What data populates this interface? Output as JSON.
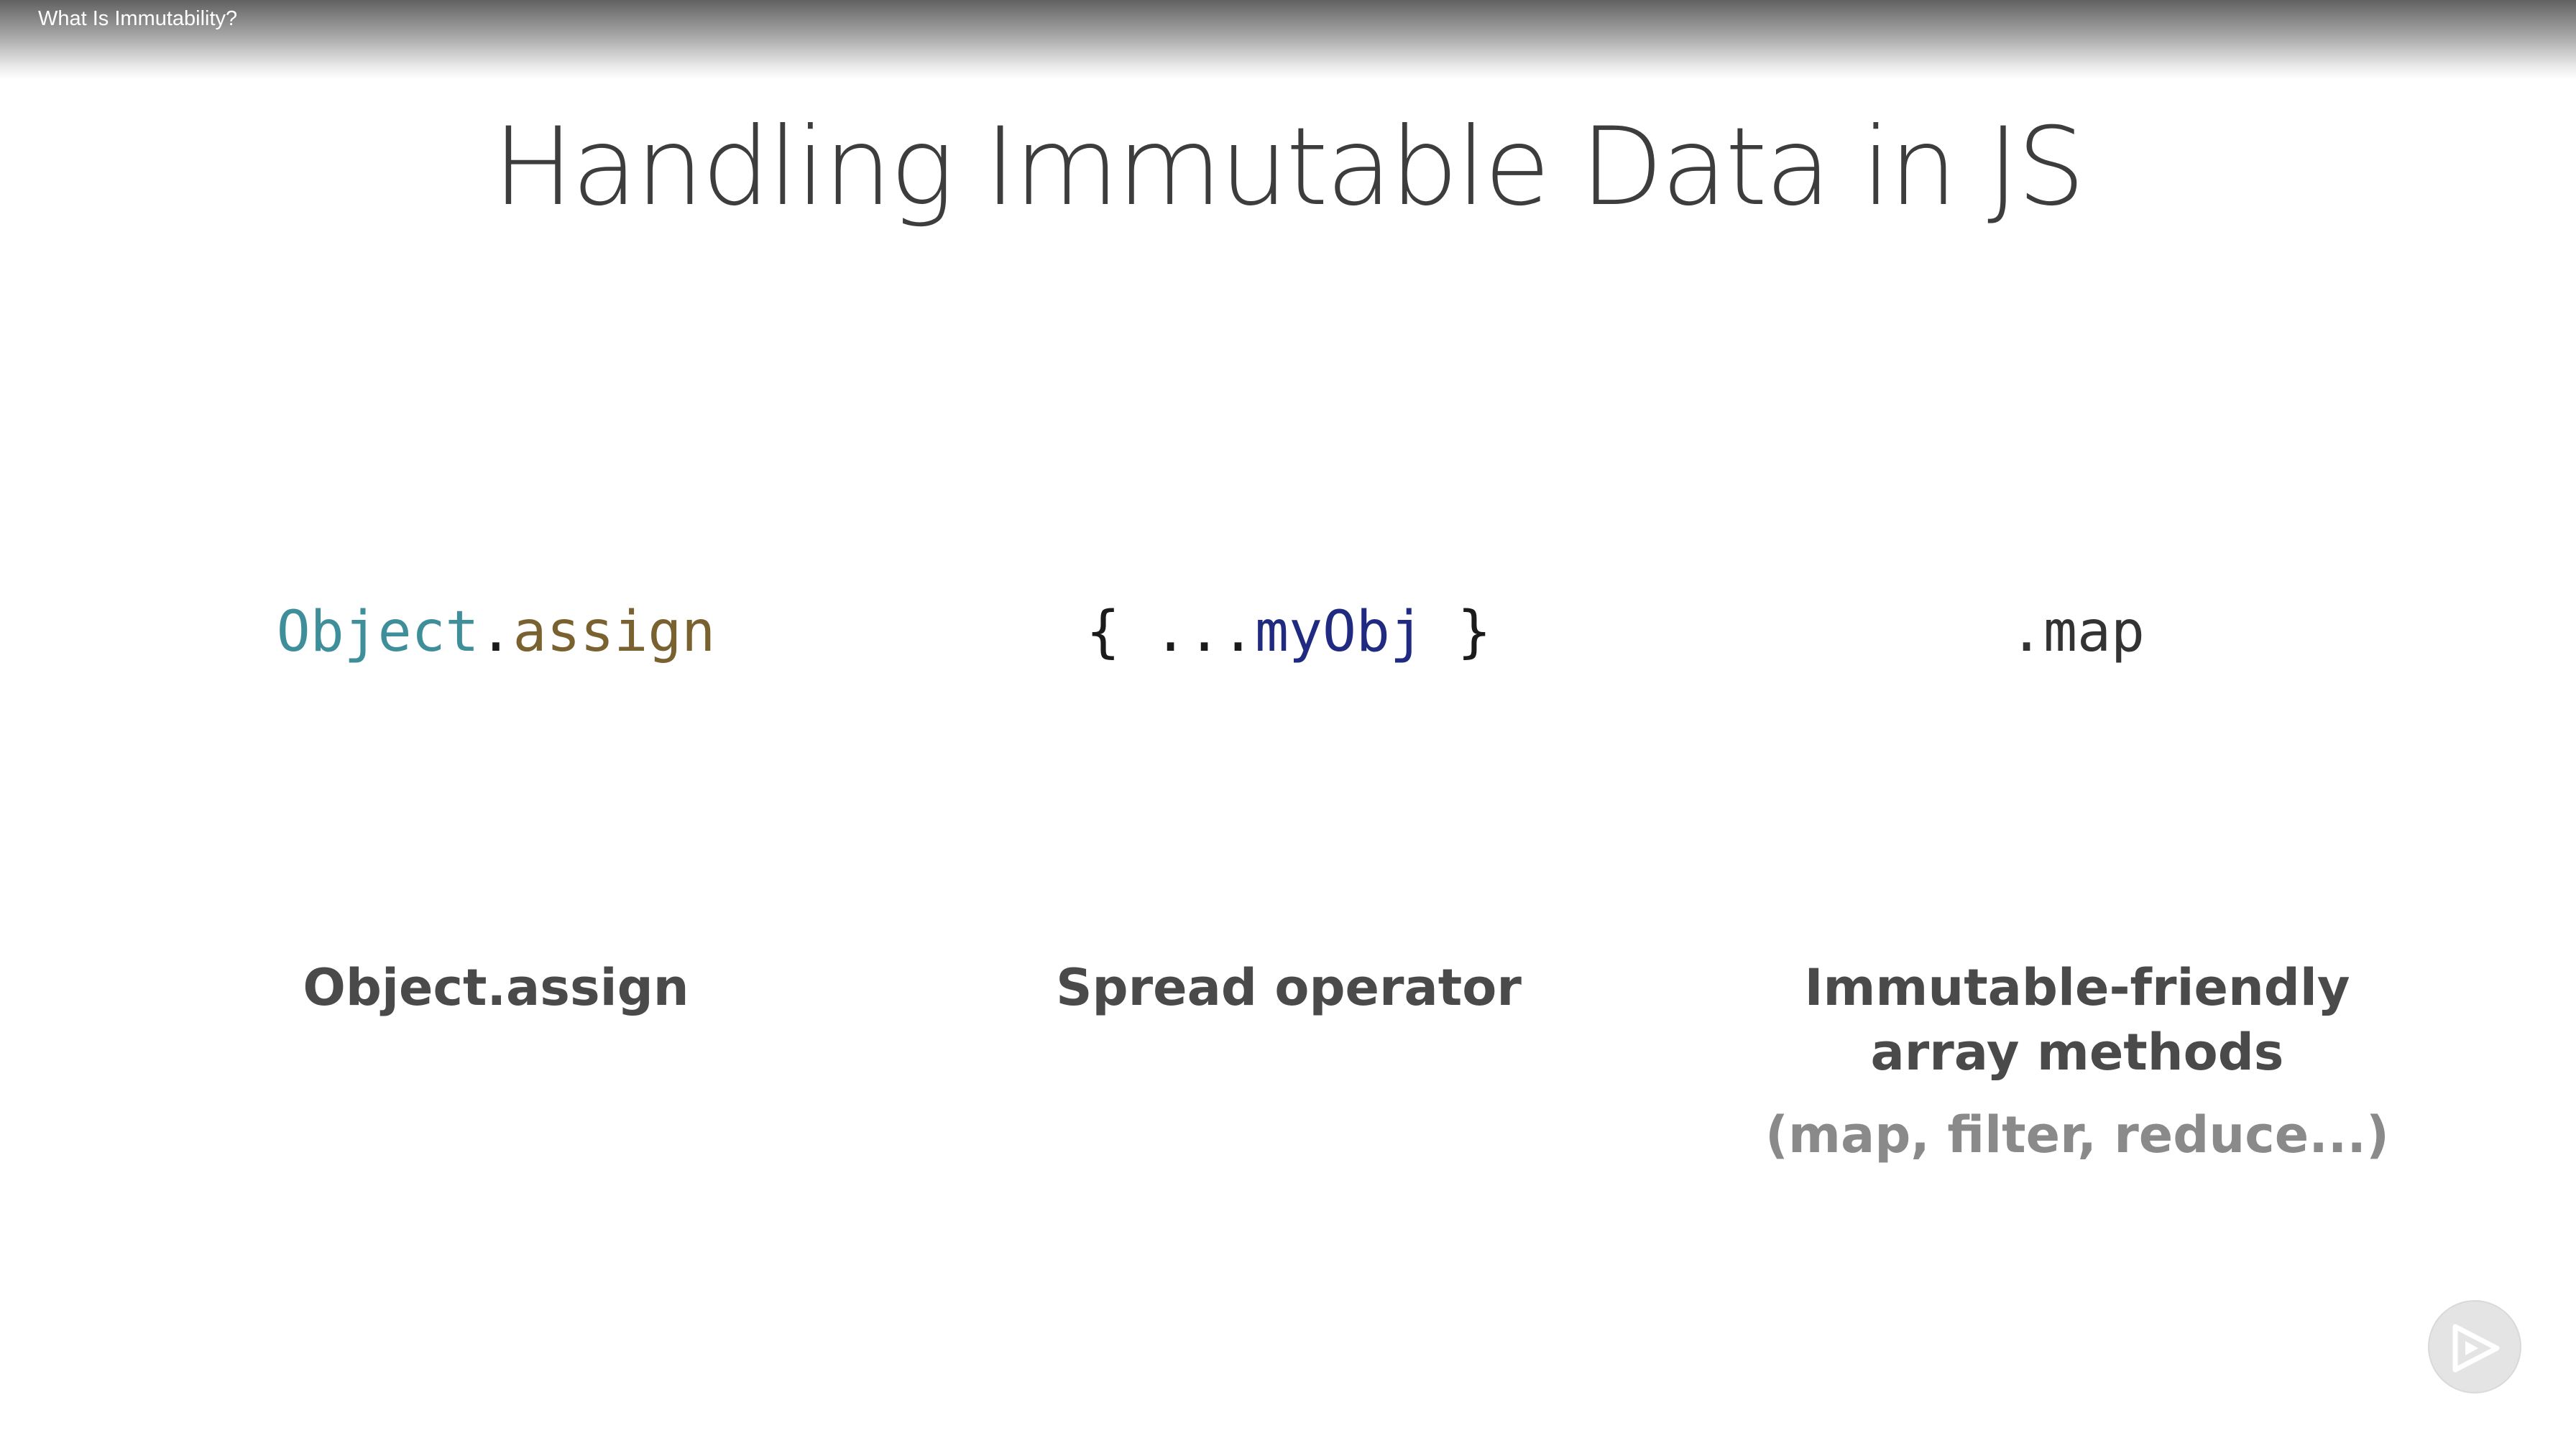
{
  "player": {
    "video_title": "What Is Immutability?"
  },
  "slide": {
    "title": "Handling Immutable Data in JS",
    "columns": [
      {
        "code_parts": [
          {
            "text": "Object",
            "color": "#3f8f9b"
          },
          {
            "text": ".",
            "color": "#1b1b1b"
          },
          {
            "text": "assign",
            "color": "#7a6230"
          }
        ],
        "label": "Object.assign"
      },
      {
        "code_parts": [
          {
            "text": "{ ...",
            "color": "#1b1b1b"
          },
          {
            "text": "myObj",
            "color": "#1f2a80"
          },
          {
            "text": " }",
            "color": "#1b1b1b"
          }
        ],
        "label": "Spread operator"
      },
      {
        "code_parts": [
          {
            "text": ".map",
            "color": "#333333"
          }
        ],
        "label": "Immutable-friendly array methods",
        "sublabel": "(map, filter, reduce...)"
      }
    ]
  },
  "controls": {
    "play_icon": "play-icon"
  }
}
